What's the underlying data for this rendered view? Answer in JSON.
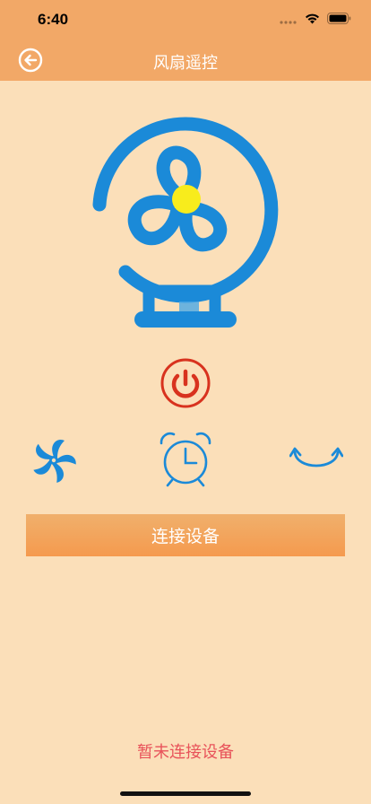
{
  "status_bar": {
    "time": "6:40"
  },
  "nav": {
    "title": "风扇遥控",
    "back_icon": "back-arrow-circle-icon"
  },
  "logo": {
    "icon": "fan-device-icon",
    "color": "#1b8ad8",
    "hub_color": "#f8ec1c"
  },
  "controls": {
    "power_icon": "power-icon",
    "power_color": "#d8321e",
    "fan_speed_icon": "fan-blade-icon",
    "timer_icon": "alarm-clock-icon",
    "swing_icon": "swing-arrows-icon",
    "icon_color": "#1b8ad8"
  },
  "connect_button": {
    "label": "连接设备"
  },
  "connection_status": "暂未连接设备",
  "colors": {
    "header": "#f2a867",
    "background": "#fbdfb9",
    "status_text": "#e8535a"
  }
}
